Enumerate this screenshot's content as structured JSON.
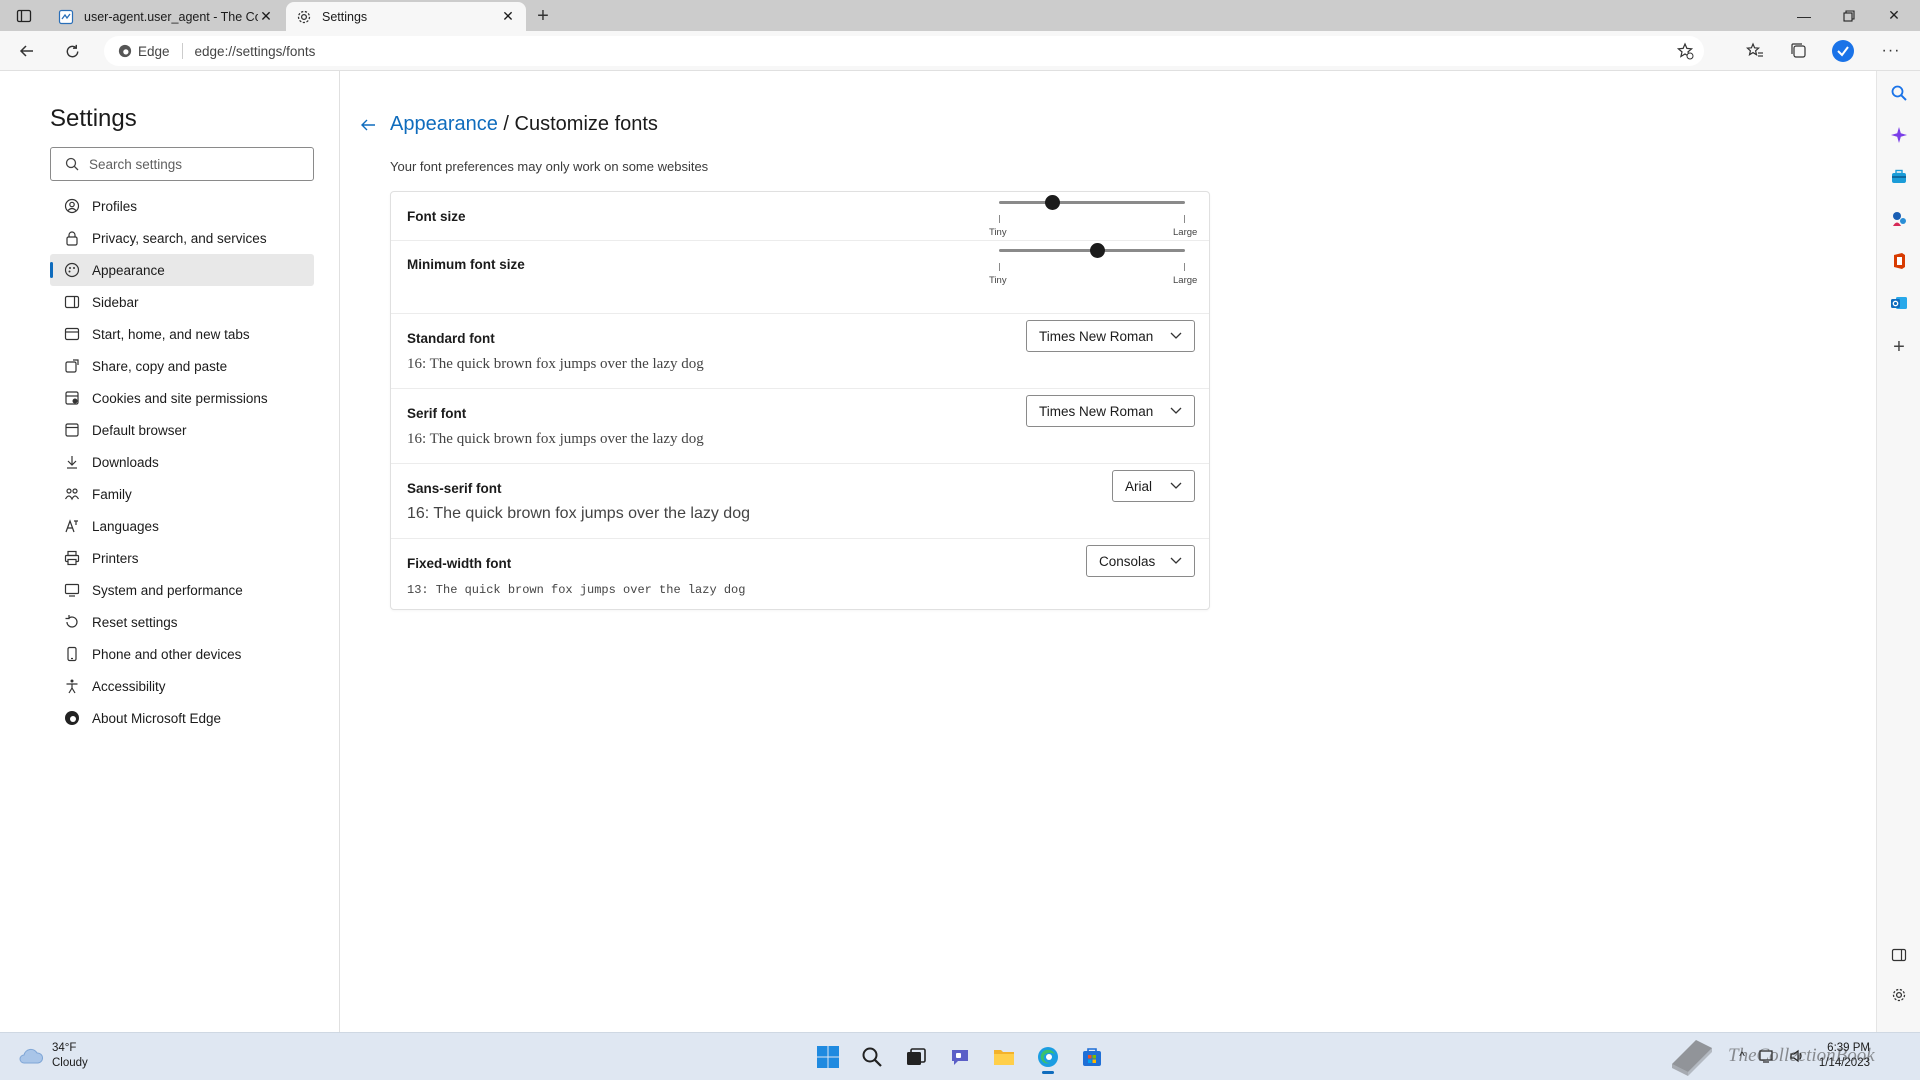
{
  "browser": {
    "tabs": [
      {
        "title": "user-agent.user_agent - The Coll",
        "active": false
      },
      {
        "title": "Settings",
        "active": true
      }
    ],
    "address_chip": "Edge",
    "url": "edge://settings/fonts"
  },
  "settings_nav": {
    "title": "Settings",
    "search_placeholder": "Search settings",
    "items": [
      {
        "label": "Profiles",
        "icon": "profile-icon"
      },
      {
        "label": "Privacy, search, and services",
        "icon": "lock-icon"
      },
      {
        "label": "Appearance",
        "icon": "appearance-icon",
        "selected": true
      },
      {
        "label": "Sidebar",
        "icon": "sidebar-icon"
      },
      {
        "label": "Start, home, and new tabs",
        "icon": "home-icon"
      },
      {
        "label": "Share, copy and paste",
        "icon": "share-icon"
      },
      {
        "label": "Cookies and site permissions",
        "icon": "cookies-icon"
      },
      {
        "label": "Default browser",
        "icon": "browser-icon"
      },
      {
        "label": "Downloads",
        "icon": "download-icon"
      },
      {
        "label": "Family",
        "icon": "family-icon"
      },
      {
        "label": "Languages",
        "icon": "languages-icon"
      },
      {
        "label": "Printers",
        "icon": "printer-icon"
      },
      {
        "label": "System and performance",
        "icon": "system-icon"
      },
      {
        "label": "Reset settings",
        "icon": "reset-icon"
      },
      {
        "label": "Phone and other devices",
        "icon": "phone-icon"
      },
      {
        "label": "Accessibility",
        "icon": "accessibility-icon"
      },
      {
        "label": "About Microsoft Edge",
        "icon": "edge-logo-icon"
      }
    ]
  },
  "page": {
    "breadcrumb_parent": "Appearance",
    "breadcrumb_sep": " / ",
    "breadcrumb_current": "Customize fonts",
    "hint": "Your font preferences may only work on some websites",
    "font_size": {
      "label": "Font size",
      "min_label": "Tiny",
      "max_label": "Large",
      "level": 0.29
    },
    "min_font_size": {
      "label": "Minimum font size",
      "min_label": "Tiny",
      "max_label": "Large",
      "level": 0.53
    },
    "standard_font": {
      "label": "Standard font",
      "value": "Times New Roman",
      "sample": "16: The quick brown fox jumps over the lazy dog"
    },
    "serif_font": {
      "label": "Serif font",
      "value": "Times New Roman",
      "sample": "16: The quick brown fox jumps over the lazy dog"
    },
    "sans_font": {
      "label": "Sans-serif font",
      "value": "Arial",
      "sample": "16: The quick brown fox jumps over the lazy dog"
    },
    "fixed_font": {
      "label": "Fixed-width font",
      "value": "Consolas",
      "sample": "13: The quick brown fox jumps over the lazy dog"
    }
  },
  "taskbar": {
    "weather_temp": "34°F",
    "weather_desc": "Cloudy",
    "time": "6:39 PM",
    "date": "1/14/2023",
    "watermark": "TheCollectionBook"
  },
  "colors": {
    "accent": "#0f6cbd",
    "tab_strip": "#cccccc",
    "taskbar": "#dfe7f2"
  }
}
